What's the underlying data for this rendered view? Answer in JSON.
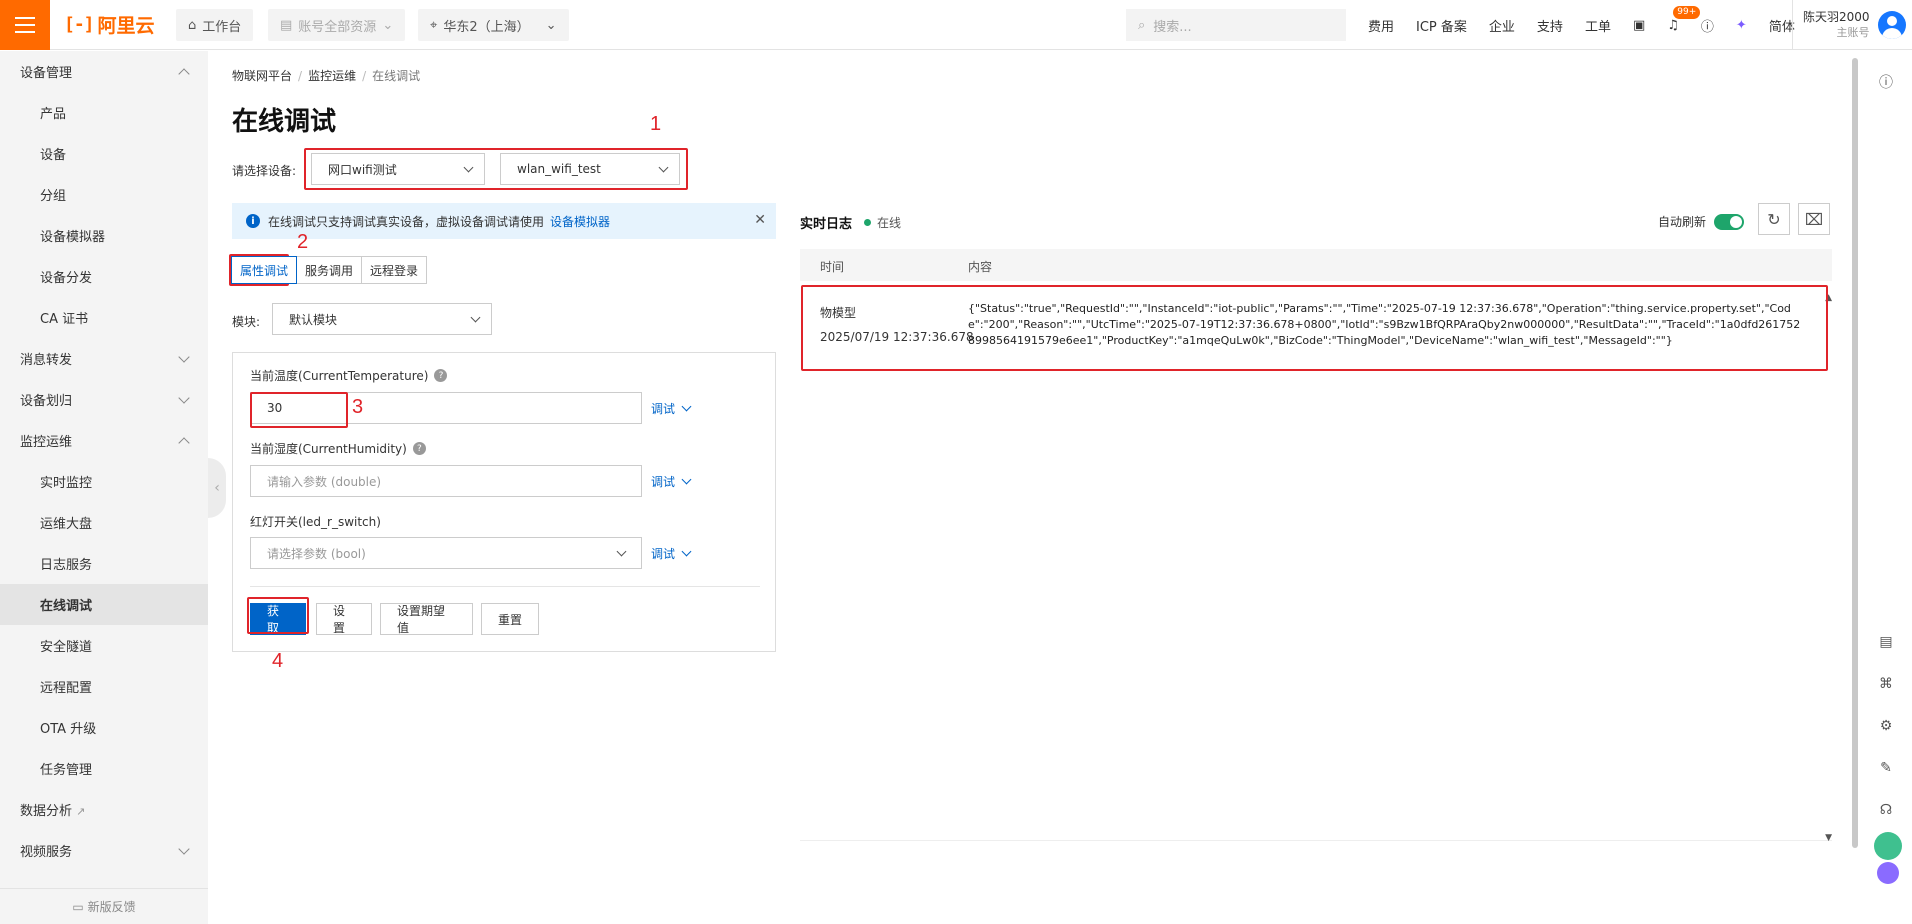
{
  "topbar": {
    "brand": "阿里云",
    "workbench": "工作台",
    "resources": "账号全部资源",
    "region": "华东2（上海）",
    "search_placeholder": "搜索...",
    "links": [
      "费用",
      "ICP 备案",
      "企业",
      "支持",
      "工单"
    ],
    "badge": "99+",
    "language": "简体",
    "username": "陈天羽2000",
    "account_type": "主账号"
  },
  "sidebar": {
    "items": [
      {
        "label": "设备管理",
        "level": 0,
        "expanded": true
      },
      {
        "label": "产品",
        "level": 1
      },
      {
        "label": "设备",
        "level": 1
      },
      {
        "label": "分组",
        "level": 1
      },
      {
        "label": "设备模拟器",
        "level": 1
      },
      {
        "label": "设备分发",
        "level": 1
      },
      {
        "label": "CA 证书",
        "level": 1
      },
      {
        "label": "消息转发",
        "level": 0,
        "expanded": false
      },
      {
        "label": "设备划归",
        "level": 0,
        "expanded": false
      },
      {
        "label": "监控运维",
        "level": 0,
        "expanded": true
      },
      {
        "label": "实时监控",
        "level": 1
      },
      {
        "label": "运维大盘",
        "level": 1
      },
      {
        "label": "日志服务",
        "level": 1
      },
      {
        "label": "在线调试",
        "level": 1,
        "active": true
      },
      {
        "label": "安全隧道",
        "level": 1
      },
      {
        "label": "远程配置",
        "level": 1
      },
      {
        "label": "OTA 升级",
        "level": 1
      },
      {
        "label": "任务管理",
        "level": 1
      },
      {
        "label": "数据分析",
        "level": 0,
        "external": true
      },
      {
        "label": "视频服务",
        "level": 0,
        "expanded": false
      }
    ],
    "feedback": "新版反馈"
  },
  "breadcrumb": [
    "物联网平台",
    "监控运维",
    "在线调试"
  ],
  "page_title": "在线调试",
  "device": {
    "label": "请选择设备:",
    "product": "网口wifi测试",
    "name": "wlan_wifi_test"
  },
  "notice": {
    "text": "在线调试只支持调试真实设备，虚拟设备调试请使用",
    "link": "设备模拟器"
  },
  "tabs": [
    "属性调试",
    "服务调用",
    "远程登录"
  ],
  "module": {
    "label": "模块:",
    "value": "默认模块"
  },
  "properties": [
    {
      "label": "当前温度(CurrentTemperature)",
      "value": "30",
      "placeholder": ""
    },
    {
      "label": "当前湿度(CurrentHumidity)",
      "value": "",
      "placeholder": "请输入参数 (double)"
    },
    {
      "label": "红灯开关(led_r_switch)",
      "value": "",
      "placeholder": "请选择参数 (bool)"
    }
  ],
  "debug_label": "调试",
  "buttons": {
    "get": "获取",
    "set": "设置",
    "set_expected": "设置期望值",
    "reset": "重置"
  },
  "annotations": [
    "1",
    "2",
    "3",
    "4"
  ],
  "log": {
    "title": "实时日志",
    "status": "在线",
    "auto_refresh": "自动刷新",
    "col_time": "时间",
    "col_content": "内容",
    "rows": [
      {
        "type": "物模型",
        "time": "2025/07/19 12:37:36.678",
        "content": "{\"Status\":\"true\",\"RequestId\":\"\",\"InstanceId\":\"iot-public\",\"Params\":\"\",\"Time\":\"2025-07-19 12:37:36.678\",\"Operation\":\"thing.service.property.set\",\"Code\":\"200\",\"Reason\":\"\",\"UtcTime\":\"2025-07-19T12:37:36.678+0800\",\"IotId\":\"s9Bzw1BfQRPAraQby2nw000000\",\"ResultData\":\"\",\"TraceId\":\"1a0dfd2617528998564191579e6ee1\",\"ProductKey\":\"a1mqeQuLw0k\",\"BizCode\":\"ThingModel\",\"DeviceName\":\"wlan_wifi_test\",\"MessageId\":\"\"}"
      }
    ]
  },
  "colors": {
    "brand": "#ff6a00",
    "primary": "#0064c8",
    "annotation": "#e0242a",
    "online": "#1ea56b"
  }
}
